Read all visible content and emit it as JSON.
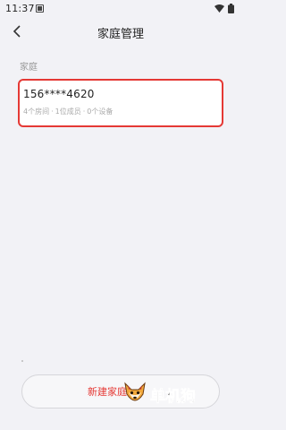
{
  "status_bar": {
    "time": "11:37"
  },
  "header": {
    "title": "家庭管理"
  },
  "section": {
    "label": "家庭"
  },
  "family_card": {
    "name": "156****4620",
    "rooms": "4个房间",
    "members": "1位成员",
    "devices": "0个设备",
    "separator": "·"
  },
  "create_button": {
    "label": "新建家庭"
  },
  "watermark": {
    "text": "单机狗"
  },
  "colors": {
    "accent": "#e53935",
    "background": "#f2f2f6"
  },
  "icons": [
    "back-arrow-icon",
    "wifi-icon",
    "battery-icon",
    "notification-icon"
  ]
}
